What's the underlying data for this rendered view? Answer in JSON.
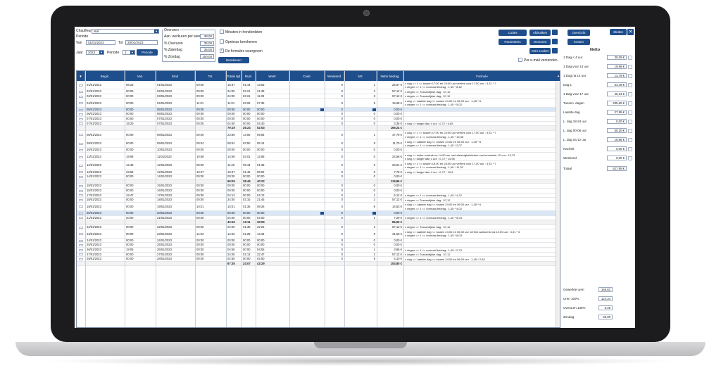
{
  "filters": {
    "chauffeur_label": "Chauffeur",
    "chauffeur_value": "staf",
    "periode_label": "Periode",
    "van_label": "Van",
    "van_value": "01/01/2023",
    "tot_label": "Tot",
    "tot_value": "28/01/2023",
    "jaar_label": "Jaar",
    "jaar_value": "2023",
    "periode2_label": "Periode",
    "periode2_value": "1",
    "periode_button": "Periode"
  },
  "overuren": {
    "title": "Overuren",
    "rows": [
      {
        "label": "Aan. werkuren per week",
        "value": "38,00"
      },
      {
        "label": "% Overuren",
        "value": "35,00"
      },
      {
        "label": "% Zaterdag",
        "value": "35,00"
      },
      {
        "label": "% Zondag",
        "value": "100,00"
      }
    ]
  },
  "options": {
    "minuten": "Minuten in honderdsten",
    "opnieuw": "Opnieuw berekenen",
    "formules": "De formules weergeven",
    "berekenen_button": "Berekenen"
  },
  "actions": {
    "codes": "Codes",
    "afdrukken": "Afdrukken",
    "parameters": "Parameters",
    "overuren": "Overuren",
    "csv": "CSV Locket",
    "email": "Per e-mail verzenden"
  },
  "table": {
    "headers": [
      "Begin",
      "Van",
      "Eind",
      "Tot",
      "Totale tijd",
      "Rust",
      "Werk",
      "Code",
      "Weekend",
      "NS",
      "Netto bedrag",
      "Formule"
    ],
    "rows": [
      {
        "begin": "01/01/2023",
        "van": "08:23",
        "eind": "01/01/2023",
        "tot": "00:00",
        "totaal": "15:37",
        "rust": "01:44",
        "werk": "13:53",
        "weekend": "0",
        "ns": "1",
        "netto": "25,67 €",
        "f": [
          "x dag => 1 <= tussen 17:00 en 24:00 uur vertrek voor 17:00 uur : 3,31 * 7",
          "x degen => 1 <= normaal bedrag : 1,45 * 8,62"
        ]
      },
      {
        "begin": "02/01/2023",
        "van": "00:00",
        "eind": "02/01/2023",
        "tot": "00:00",
        "totaal": "24:00",
        "rust": "02:21",
        "werk": "21:39",
        "weekend": "0",
        "ns": "2",
        "netto": "57,12 €",
        "f": [
          "x degen => Tussentijdse dag : 57,12"
        ]
      },
      {
        "begin": "03/01/2023",
        "van": "00:00",
        "eind": "03/01/2023",
        "tot": "00:00",
        "totaal": "24:00",
        "rust": "02:21",
        "werk": "11:39",
        "weekend": "0",
        "ns": "3",
        "netto": "57,12 €",
        "f": [
          "x degen => Tussentijdse dag : 57,12"
        ]
      },
      {
        "begin": "04/01/2023",
        "van": "00:00",
        "eind": "04/01/2023",
        "tot": "11:01",
        "totaal": "11:01",
        "rust": "03:26",
        "werk": "07:35",
        "weekend": "0",
        "ns": "9",
        "netto": "15,98 €",
        "f": [
          "x dag => Laatste dag <= tussen 24:00 en 06:00 uur : 1,45 * 6",
          "x degen => 1 <= normaal bedrag : 1,45 * 5,02"
        ]
      },
      {
        "begin": "05/01/2023",
        "van": "00:00",
        "eind": "05/01/2023",
        "tot": "00:00",
        "totaal": "00:00",
        "rust": "00:00",
        "werk": "00:00",
        "weekend": "0",
        "ns": "0",
        "netto": "0,00 €",
        "sel": true,
        "f": []
      },
      {
        "begin": "06/01/2023",
        "van": "00:00",
        "eind": "06/01/2023",
        "tot": "00:00",
        "totaal": "00:00",
        "rust": "00:00",
        "werk": "00:00",
        "weekend": "0",
        "ns": "0",
        "netto": "0,00 €",
        "f": []
      },
      {
        "begin": "07/01/2023",
        "van": "00:00",
        "eind": "07/01/2023",
        "tot": "00:00",
        "totaal": "00:00",
        "rust": "00:00",
        "werk": "00:00",
        "weekend": "0",
        "ns": "0",
        "netto": "0,00 €",
        "f": []
      },
      {
        "begin": "07/01/2023",
        "van": "19:20",
        "eind": "07/01/2023",
        "tot": "00:00",
        "totaal": "04:40",
        "rust": "00:00",
        "werk": "04:40",
        "weekend": "0",
        "ns": "0",
        "netto": "3,36 €",
        "f": [
          "x dag => langer dan 4 uur : 0,72 * 4,65"
        ]
      },
      {
        "sum": true,
        "totaal": "79:19",
        "rust": "26:24",
        "werk": "52:53",
        "netto": "169,24 €",
        "f": []
      },
      {
        "begin": "08/01/2023",
        "van": "00:00",
        "eind": "08/01/2023",
        "tot": "00:00",
        "totaal": "23:59",
        "rust": "14:05",
        "werk": "09:54",
        "weekend": "0",
        "ns": "1",
        "netto": "47,79 €",
        "f": [
          "x dag => 1 <= tussen 17:00 en 24:00 uur vertrek voor 17:00 uur : 3,31 * 7",
          "x degen => 1 <= normaal bedrag : 1,45 * 16,98"
        ]
      },
      {
        "begin": "09/01/2023",
        "van": "00:00",
        "eind": "09/01/2023",
        "tot": "08:04",
        "totaal": "08:04",
        "rust": "02:50",
        "werk": "05:14",
        "weekend": "0",
        "ns": "9",
        "netto": "11,70 €",
        "f": [
          "x dag => Laatste dag <= tussen 24:00 en 06:00 uur : 1,45 * 6",
          "x degen => 1 <= normaal bedrag : 1,45 * 2,07"
        ]
      },
      {
        "begin": "10/01/2023",
        "van": "00:00",
        "eind": "10/01/2023",
        "tot": "00:00",
        "totaal": "00:00",
        "rust": "00:00",
        "werk": "00:00",
        "weekend": "0",
        "ns": "0",
        "netto": "0,00 €",
        "f": []
      },
      {
        "begin": "11/01/2023",
        "van": "19:59",
        "eind": "11/01/2023",
        "tot": "10:58",
        "totaal": "14:59",
        "rust": "02:01",
        "werk": "12:58",
        "weekend": "0",
        "ns": "0",
        "netto": "24,58 €",
        "f": [
          "x dag => Indien vertrek na 14:00 uur met afwezigheidsduur van tenminste 12 uur : 13,79",
          "x dag => langer dan 4 uur : 0,72 * 14,98"
        ]
      },
      {
        "begin": "12/01/2023",
        "van": "12:48",
        "eind": "12/01/2023",
        "tot": "00:00",
        "totaal": "11:20",
        "rust": "09:44",
        "werk": "01:36",
        "weekend": "0",
        "ns": "0",
        "netto": "28,01 €",
        "f": [
          "x dag => 1 <= tussen 18.00 en 24:00 uur vertrek voor 17.00 uur : 3,31 * 7",
          "x degen => 1 <= normaal bedrag : 1,45 * 11,32"
        ]
      },
      {
        "begin": "12/01/2023",
        "van": "23:59",
        "eind": "12/01/2023",
        "tot": "10:47",
        "totaal": "10:47",
        "rust": "01:46",
        "werk": "09:02",
        "weekend": "0",
        "ns": "0",
        "netto": "7,78 €",
        "f": [
          "x dag => langer dan 4 uur : 0,72 * 10,8"
        ]
      },
      {
        "begin": "14/01/2023",
        "van": "00:00",
        "eind": "14/01/2023",
        "tot": "00:00",
        "totaal": "00:00",
        "rust": "00:00",
        "werk": "00:00",
        "weekend": "0",
        "ns": "0",
        "netto": "0,00 €",
        "f": []
      },
      {
        "sum": true,
        "totaal": "69:09",
        "rust": "28:46",
        "werk": "40:22",
        "netto": "119,86 €",
        "f": []
      },
      {
        "begin": "15/01/2023",
        "van": "00:00",
        "eind": "15/01/2023",
        "tot": "00:00",
        "totaal": "00:00",
        "rust": "00:00",
        "werk": "00:00",
        "weekend": "0",
        "ns": "0",
        "netto": "0,00 €",
        "f": []
      },
      {
        "begin": "16/01/2023",
        "van": "00:00",
        "eind": "16/01/2023",
        "tot": "00:00",
        "totaal": "00:00",
        "rust": "00:00",
        "werk": "00:00",
        "weekend": "0",
        "ns": "0",
        "netto": "0,00 €",
        "f": []
      },
      {
        "begin": "17/01/2023",
        "van": "19:47",
        "eind": "17/01/2023",
        "tot": "00:00",
        "totaal": "04:13",
        "rust": "00:00",
        "werk": "04:13",
        "weekend": "0",
        "ns": "1",
        "netto": "6,12 €",
        "f": [
          "x degen => 1 <= normaal bedrag : 1,45 * 4,22"
        ]
      },
      {
        "begin": "18/01/2023",
        "van": "00:00",
        "eind": "18/01/2023",
        "tot": "00:00",
        "totaal": "24:00",
        "rust": "02:15",
        "werk": "21:45",
        "weekend": "0",
        "ns": "2",
        "netto": "57,12 €",
        "f": [
          "x degen => Tussentijdse dag : 57,12"
        ]
      },
      {
        "begin": "19/01/2023",
        "van": "00:00",
        "eind": "19/01/2023",
        "tot": "10:01",
        "totaal": "10:01",
        "rust": "01:35",
        "werk": "08:26",
        "weekend": "0",
        "ns": "9",
        "netto": "14,53 €",
        "f": [
          "x dag => Laatste dag <= tussen 24:00 en 06:00 uur : 1,45 * 6",
          "x degen => 1 <= normaal bedrag : 1,45 * 4,02"
        ]
      },
      {
        "begin": "20/01/2023",
        "van": "00:00",
        "eind": "20/01/2023",
        "tot": "00:00",
        "totaal": "00:00",
        "rust": "00:00",
        "werk": "00:00",
        "weekend": "0",
        "ns": "0",
        "netto": "0,00 €",
        "sel": true,
        "f": []
      },
      {
        "begin": "21/01/2023",
        "van": "20:00",
        "eind": "21/01/2023",
        "tot": "00:00",
        "totaal": "04:00",
        "rust": "00:00",
        "werk": "04:00",
        "weekend": "0",
        "ns": "1",
        "netto": "7,29 €",
        "f": [
          "x degen => 1 <= normaal bedrag : 1,45 * 5,03"
        ]
      },
      {
        "sum": true,
        "totaal": "43:16",
        "rust": "13:11",
        "werk": "30:05",
        "netto": "85,06 €",
        "f": []
      },
      {
        "begin": "22/01/2023",
        "van": "00:00",
        "eind": "22/01/2023",
        "tot": "00:00",
        "totaal": "24:00",
        "rust": "01:38",
        "werk": "22:22",
        "weekend": "0",
        "ns": "2",
        "netto": "57,12 €",
        "f": [
          "x degen => Tussentijdse dag : 57,12"
        ]
      },
      {
        "begin": "23/01/2023",
        "van": "00:00",
        "eind": "23/01/2023",
        "tot": "14:02",
        "totaal": "14:02",
        "rust": "01:28",
        "werk": "12:34",
        "weekend": "0",
        "ns": "9",
        "netto": "31,50 €",
        "f": [
          "x dag => Laatste dag <= tussen 24:00 en 06:00 uur vertrek aankomst na 12:00 uur : 3,31 * 6",
          "x degen => 1 <= normaal bedrag : 1,45 * 8,03"
        ]
      },
      {
        "begin": "24/01/2023",
        "van": "00:00",
        "eind": "24/01/2023",
        "tot": "00:00",
        "totaal": "00:00",
        "rust": "00:00",
        "werk": "00:00",
        "weekend": "0",
        "ns": "0",
        "netto": "0,00 €",
        "f": []
      },
      {
        "begin": "25/01/2023",
        "van": "00:00",
        "eind": "25/01/2023",
        "tot": "00:00",
        "totaal": "00:00",
        "rust": "00:00",
        "werk": "00:00",
        "weekend": "0",
        "ns": "0",
        "netto": "0,00 €",
        "f": []
      },
      {
        "begin": "26/01/2023",
        "van": "19:05",
        "eind": "26/01/2023",
        "tot": "00:00",
        "totaal": "04:55",
        "rust": "00:00",
        "werk": "04:55",
        "weekend": "0",
        "ns": "1",
        "netto": "3,96 €",
        "f": [
          "x degen => 1 <= normaal bedrag : 1,45 * 2,73"
        ]
      },
      {
        "begin": "27/01/2023",
        "van": "00:00",
        "eind": "27/01/2023",
        "tot": "00:00",
        "totaal": "24:00",
        "rust": "01:13",
        "werk": "22:47",
        "weekend": "0",
        "ns": "2",
        "netto": "57,12 €",
        "f": [
          "x degen => Tussentijdse dag : 57,12"
        ]
      },
      {
        "begin": "28/01/2023",
        "van": "00:00",
        "eind": "28/01/2023",
        "tot": "00:00",
        "totaal": "02:50",
        "rust": "00:00",
        "werk": "02:50",
        "weekend": "0",
        "ns": "9",
        "netto": "4,10 €",
        "f": [
          "x dag => Laatste dag <= tussen 24:00 en 06:00 uur : 1,45 * 2,83"
        ]
      },
      {
        "sum": true,
        "totaal": "67:35",
        "rust": "24:07",
        "werk": "43:29",
        "netto": "153,80 €",
        "f": []
      }
    ]
  },
  "panel": {
    "overzicht": "Overzicht",
    "sluiten": "Sluiten",
    "kosten": "Kosten",
    "netto_title": "Netto",
    "items": [
      {
        "label": "1 Dag < 4 uur",
        "value": "30,06 €"
      },
      {
        "label": "1 Dag voor 14 uur",
        "value": "19,86 €"
      },
      {
        "label": "1 Dag na 14 uur",
        "value": "13,79 €"
      },
      {
        "label": "Dag 1",
        "value": "54,49 €"
      },
      {
        "label": "1 Dag voor 17 uur",
        "value": "46,34 €"
      },
      {
        "label": "Tussen. dagen",
        "value": "285,60 €"
      },
      {
        "label": "Laatste dag",
        "value": "27,95 €"
      },
      {
        "label": "L. dag 18-24 uur",
        "value": "0,00 €"
      },
      {
        "label": "L. dag 00-06 uur",
        "value": "50,20 €"
      },
      {
        "label": "L. dag na 12 uur",
        "value": "19,86 €"
      },
      {
        "label": "Nachtrit",
        "value": "0,00 €"
      },
      {
        "label": "Weekend",
        "value": "0,00 €"
      }
    ],
    "totaal_label": "Totaal",
    "totaal_value": "527,95 €",
    "bottom": [
      {
        "label": "Gewerkte uren",
        "value": "166,82"
      },
      {
        "label": "Uren 100%",
        "value": "124,34"
      },
      {
        "label": "Overuren 135%",
        "value": "6,48"
      },
      {
        "label": "Zondag",
        "value": "35,90"
      }
    ]
  }
}
